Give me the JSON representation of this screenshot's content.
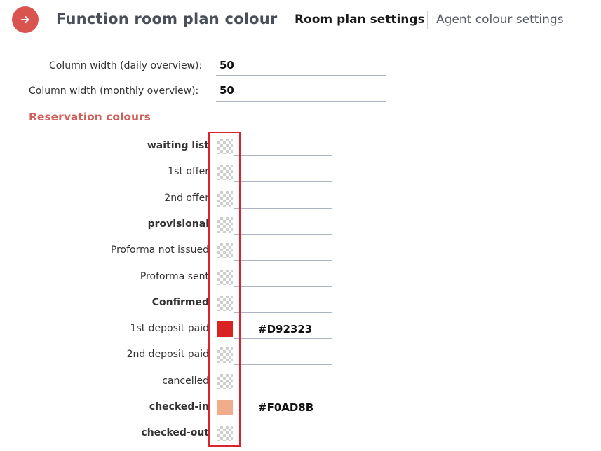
{
  "header": {
    "title": "Function room plan colour",
    "nav_icon": "arrow-right-icon",
    "accent_color": "#D9534F",
    "tabs": [
      {
        "label": "Room plan settings",
        "active": true
      },
      {
        "label": "Agent colour settings",
        "active": false
      }
    ]
  },
  "settings": {
    "daily": {
      "label": "Column width (daily overview):",
      "value": "50"
    },
    "monthly": {
      "label": "Column width (monthly overview):",
      "value": "50"
    }
  },
  "reservation": {
    "section_title": "Reservation colours",
    "rows": [
      {
        "label": "waiting list",
        "bold": true,
        "hex": ""
      },
      {
        "label": "1st offer",
        "bold": false,
        "hex": ""
      },
      {
        "label": "2nd offer",
        "bold": false,
        "hex": ""
      },
      {
        "label": "provisional",
        "bold": true,
        "hex": ""
      },
      {
        "label": "Proforma not issued",
        "bold": false,
        "hex": ""
      },
      {
        "label": "Proforma sent",
        "bold": false,
        "hex": ""
      },
      {
        "label": "Confirmed",
        "bold": true,
        "hex": ""
      },
      {
        "label": "1st deposit paid",
        "bold": false,
        "hex": "#D92323"
      },
      {
        "label": "2nd deposit paid",
        "bold": false,
        "hex": ""
      },
      {
        "label": "cancelled",
        "bold": false,
        "hex": ""
      },
      {
        "label": "checked-in",
        "bold": true,
        "hex": "#F0AD8B"
      },
      {
        "label": "checked-out",
        "bold": true,
        "hex": ""
      }
    ]
  }
}
